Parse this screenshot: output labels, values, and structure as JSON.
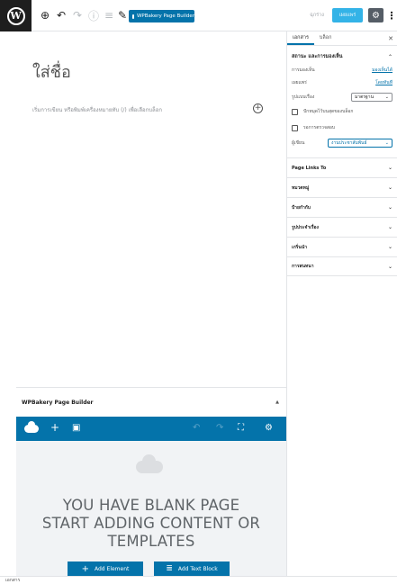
{
  "toolbar": {
    "wpbakery_label": "WPBakery Page Builder",
    "save_label": "ฉุกร่าง",
    "publish_label": "เผยแพร่",
    "settings_icon": "gear-icon",
    "more_icon": "kebab-icon"
  },
  "editor": {
    "title_placeholder": "ใส่ชื่อ",
    "block_placeholder": "เริ่มการเขียน หรือพิมพ์เครื่องหมายทับ (/) เพื่อเลือกบล็อก"
  },
  "wpbakery": {
    "title": "WPBakery Page Builder",
    "blank_line1": "YOU HAVE BLANK PAGE",
    "blank_line2": "START ADDING CONTENT OR",
    "blank_line3": "TEMPLATES",
    "add_element": "Add Element",
    "add_text_block": "Add Text Block"
  },
  "sidebar": {
    "tab_document": "เอกสาร",
    "tab_block": "บล็อก",
    "status_heading": "สถานะ และการมองเห็น",
    "visibility_label": "การมองเห็น",
    "visibility_value": "มองเห็นได้",
    "publish_label": "เผยแพร่",
    "publish_value": "โดยทันที",
    "format_label": "รูปแบบเรื่อง",
    "format_value": "มาตรฐาน",
    "sticky_label": "ปักหมุดไว้บนสุดของบล็อก",
    "pending_label": "รอการตรวจสอบ",
    "author_label": "ผู้เขียน",
    "author_value": "งานประชาสัมพันธ์",
    "panels": [
      "Page Links To",
      "หมวดหมู่",
      "ป้ายกำกับ",
      "รูปประจำเรื่อง",
      "เกริ่นนำ",
      "การสนทนา"
    ]
  },
  "status_bar": {
    "text": "เอกสาร"
  }
}
